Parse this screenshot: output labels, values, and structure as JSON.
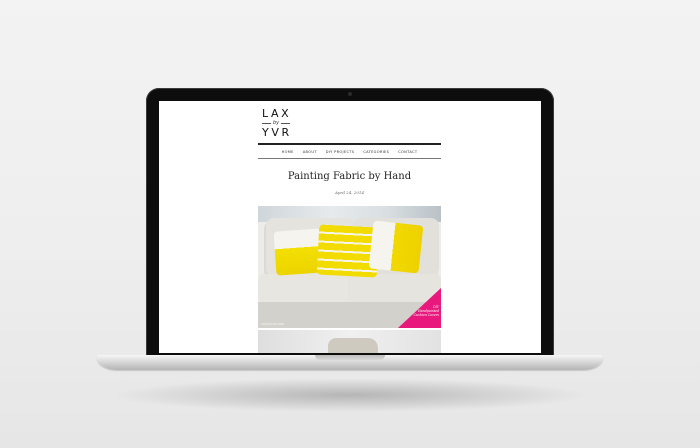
{
  "site": {
    "logo": {
      "top": "LAX",
      "mid": "by",
      "bottom": "YVR"
    },
    "nav": [
      {
        "label": "HOME"
      },
      {
        "label": "ABOUT"
      },
      {
        "label": "DIY PROJECTS"
      },
      {
        "label": "CATEGORIES"
      },
      {
        "label": "CONTACT"
      }
    ],
    "post": {
      "title": "Painting Fabric by Hand",
      "date": "April 24, 2014"
    },
    "photo": {
      "badge_lines": [
        "DIY",
        "Handpainted",
        "Cushion Covers"
      ],
      "watermark": "LAXTOYVR.COM"
    }
  },
  "colors": {
    "accent_pink": "#e8187d",
    "pillow_yellow": "#f2dc00"
  }
}
